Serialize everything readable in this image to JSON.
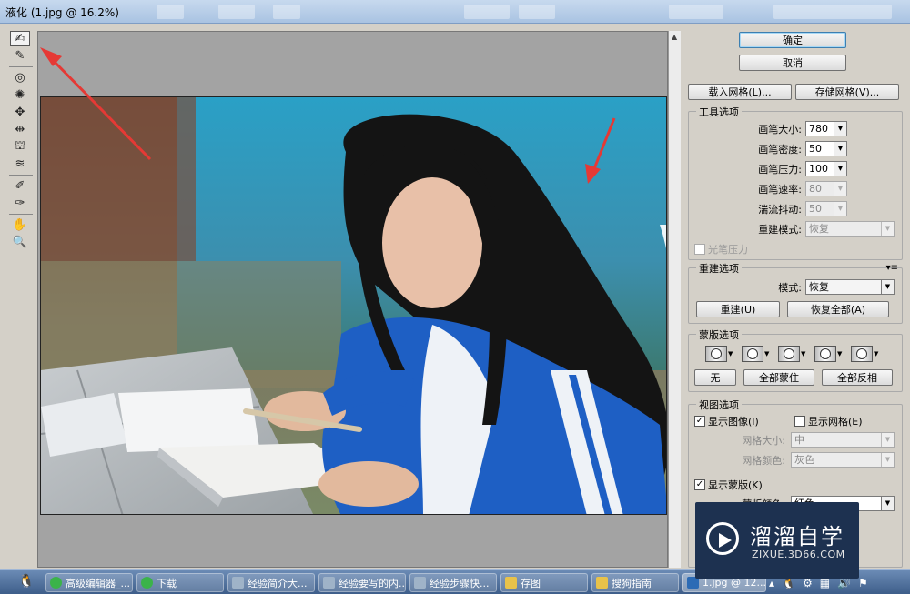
{
  "window": {
    "title": "液化 (1.jpg @ 16.2%)"
  },
  "toolbox": {
    "tools": [
      {
        "name": "forward-warp-tool",
        "glyph": "✍"
      },
      {
        "name": "reconstruct-tool",
        "glyph": "✎"
      },
      {
        "name": "twirl-tool",
        "glyph": "◎"
      },
      {
        "name": "pucker-tool",
        "glyph": "✺"
      },
      {
        "name": "bloat-tool",
        "glyph": "✥"
      },
      {
        "name": "push-left-tool",
        "glyph": "⇹"
      },
      {
        "name": "mirror-tool",
        "glyph": "⛫"
      },
      {
        "name": "turbulence-tool",
        "glyph": "≋"
      },
      {
        "name": "freeze-mask-tool",
        "glyph": "✐"
      },
      {
        "name": "thaw-mask-tool",
        "glyph": "✑"
      },
      {
        "name": "hand-tool",
        "glyph": "✋"
      },
      {
        "name": "zoom-tool",
        "glyph": "🔍"
      }
    ]
  },
  "panel": {
    "ok_label": "确定",
    "cancel_label": "取消",
    "load_mesh_label": "载入网格(L)...",
    "save_mesh_label": "存储网格(V)...",
    "tool_options": {
      "title": "工具选项",
      "brush_size_label": "画笔大小:",
      "brush_size": "780",
      "brush_density_label": "画笔密度:",
      "brush_density": "50",
      "brush_pressure_label": "画笔压力:",
      "brush_pressure": "100",
      "brush_rate_label": "画笔速率:",
      "brush_rate": "80",
      "turbulent_jitter_label": "湍流抖动:",
      "turbulent_jitter": "50",
      "reconstruct_mode_label": "重建模式:",
      "reconstruct_mode": "恢复",
      "stylus_pressure_label": "光笔压力"
    },
    "reconstruct_options": {
      "title": "重建选项",
      "mode_label": "模式:",
      "mode": "恢复",
      "reconstruct_label": "重建(U)",
      "restore_all_label": "恢复全部(A)"
    },
    "mask_options": {
      "title": "蒙版选项",
      "none_label": "无",
      "mask_all_label": "全部蒙住",
      "invert_all_label": "全部反相"
    },
    "view_options": {
      "title": "视图选项",
      "show_image_label": "显示图像(I)",
      "show_mesh_label": "显示网格(E)",
      "mesh_size_label": "网格大小:",
      "mesh_size": "中",
      "mesh_color_label": "网格颜色:",
      "mesh_color": "灰色",
      "show_mask_label": "显示蒙版(K)",
      "mask_color_label": "蒙版颜色:",
      "mask_color": "红色"
    }
  },
  "taskbar": {
    "items": [
      {
        "label": "高级编辑器_...",
        "color": "#3bb34a"
      },
      {
        "label": "下载",
        "color": "#3bb34a"
      },
      {
        "label": "经验简介大...",
        "color": "#9fb3c8"
      },
      {
        "label": "经验要写的内...",
        "color": "#9fb3c8"
      },
      {
        "label": "经验步骤快...",
        "color": "#9fb3c8"
      },
      {
        "label": "存图",
        "color": "#e8c24a"
      },
      {
        "label": "搜狗指南",
        "color": "#e8c24a"
      },
      {
        "label": "1.jpg @ 12....",
        "color": "#2c6bb5"
      }
    ]
  },
  "watermark": {
    "title": "溜溜自学",
    "subtitle": "ZIXUE.3D66.COM"
  },
  "colors": {
    "arrow": "#e53935",
    "jacket": "#1e5fc4",
    "backdrop": "#29a3c9"
  }
}
